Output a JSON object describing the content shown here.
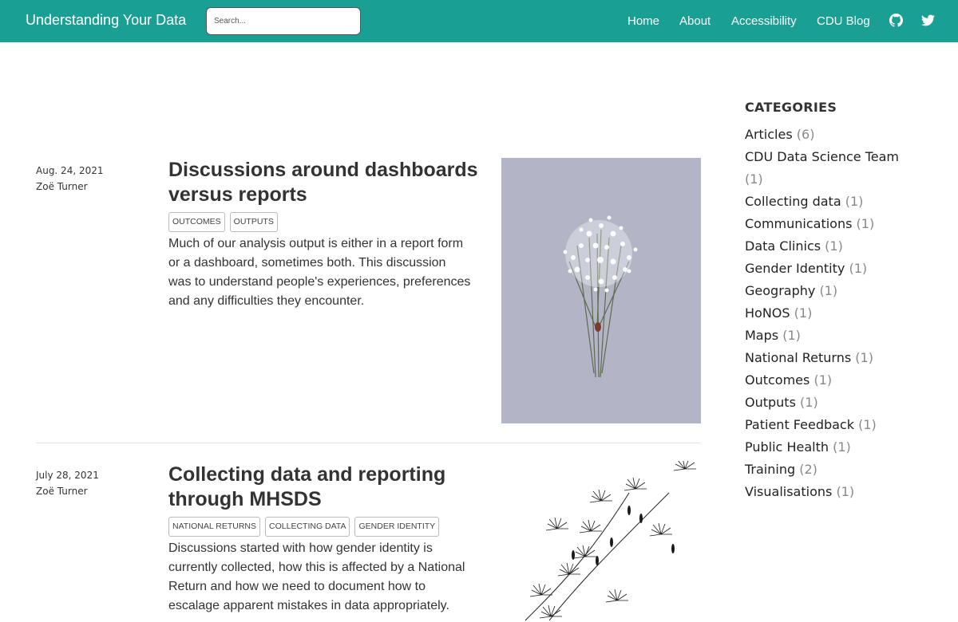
{
  "header": {
    "brand": "Understanding Your Data",
    "search_placeholder": "Search...",
    "nav": [
      "Home",
      "About",
      "Accessibility",
      "CDU Blog"
    ],
    "icons": [
      "github-icon",
      "twitter-icon"
    ],
    "background": "#1a9f94"
  },
  "posts": [
    {
      "date": "Aug. 24, 2021",
      "author": "Zoë Turner",
      "title": "Discussions around dashboards versus reports",
      "tags": [
        "OUTPUTS",
        "OUTCOMES"
      ],
      "excerpt": "Much of our analysis output is either in a report form or a dashboard, sometimes both. This discussion was to understand people's experiences, preferences and any difficulties they encounter.",
      "image": "white-flower-bouquet-illustration"
    },
    {
      "date": "July 28, 2021",
      "author": "Zoë Turner",
      "title": "Collecting data and reporting through MHSDS",
      "tags": [
        "NATIONAL RETURNS",
        "COLLECTING DATA",
        "GENDER IDENTITY"
      ],
      "excerpt": "Discussions started with how gender identity is currently collected, how this is affected by a National Return and how we need to document how to escalage apparent mistakes in data appropriately.",
      "image": "dandelion-seeds-illustration"
    }
  ],
  "sidebar": {
    "heading": "CATEGORIES",
    "categories": [
      {
        "name": "Articles",
        "count": "(6)"
      },
      {
        "name": "CDU Data Science Team",
        "count": "(1)"
      },
      {
        "name": "Collecting data",
        "count": "(1)"
      },
      {
        "name": "Communications",
        "count": "(1)"
      },
      {
        "name": "Data Clinics",
        "count": "(1)"
      },
      {
        "name": "Gender Identity",
        "count": "(1)"
      },
      {
        "name": "Geography",
        "count": "(1)"
      },
      {
        "name": "HoNOS",
        "count": "(1)"
      },
      {
        "name": "Maps",
        "count": "(1)"
      },
      {
        "name": "National Returns",
        "count": "(1)"
      },
      {
        "name": "Outcomes",
        "count": "(1)"
      },
      {
        "name": "Outputs",
        "count": "(1)"
      },
      {
        "name": "Patient Feedback",
        "count": "(1)"
      },
      {
        "name": "Public Health",
        "count": "(1)"
      },
      {
        "name": "Training",
        "count": "(2)"
      },
      {
        "name": "Visualisations",
        "count": "(1)"
      }
    ]
  }
}
